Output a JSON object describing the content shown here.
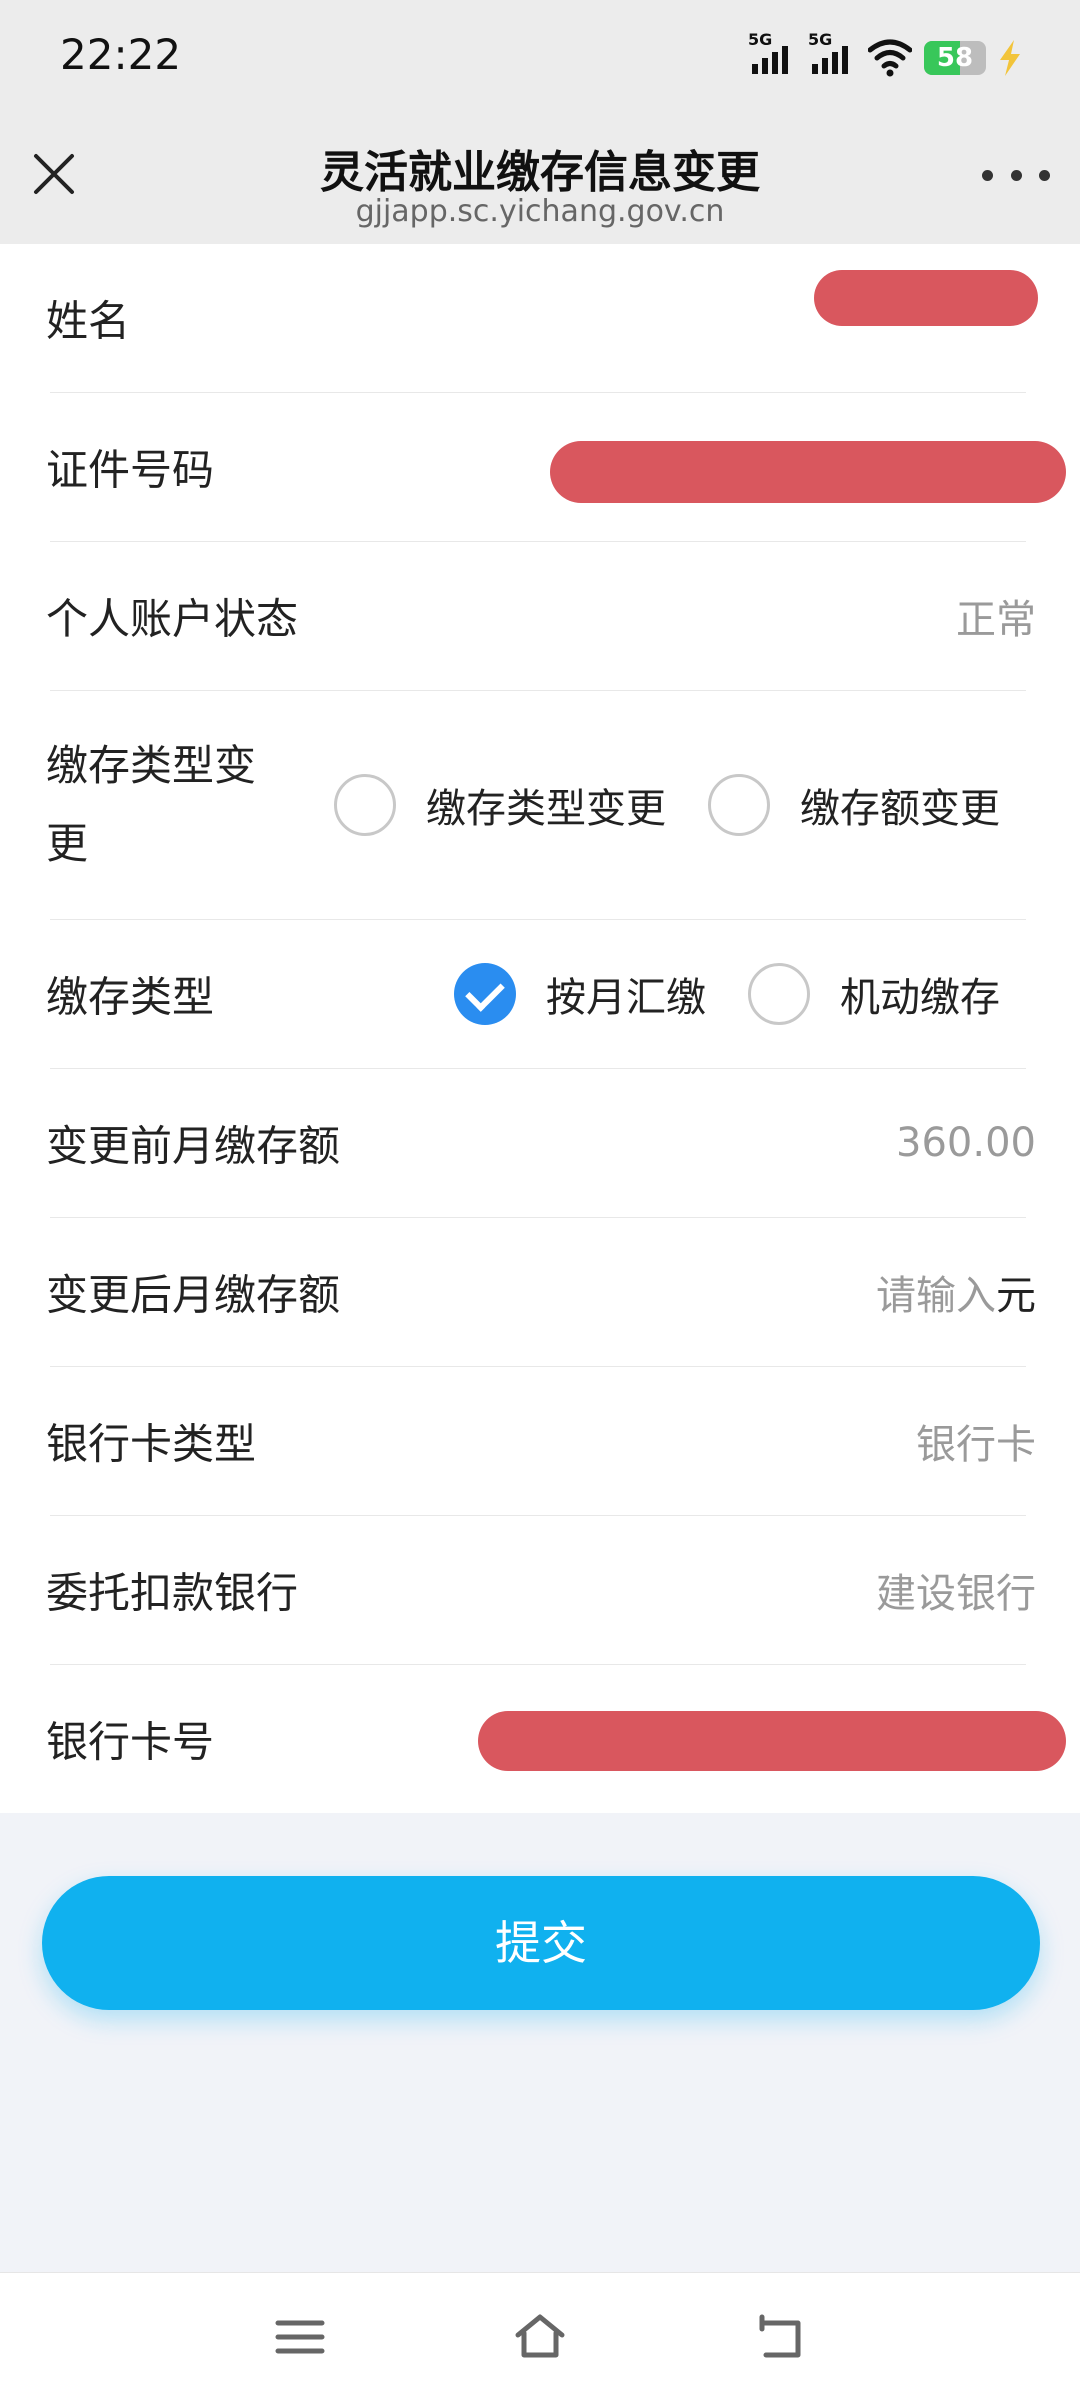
{
  "status": {
    "time": "22:22",
    "signal1_label": "5G",
    "signal2_label": "5G",
    "battery_percent": "58"
  },
  "header": {
    "title": "灵活就业缴存信息变更",
    "url": "gjjapp.sc.yichang.gov.cn"
  },
  "form": {
    "name": {
      "label": "姓名",
      "value_redacted": true
    },
    "id_number": {
      "label": "证件号码",
      "value_redacted": true
    },
    "account_status": {
      "label": "个人账户状态",
      "value": "正常"
    },
    "change_type": {
      "label": "缴存类型变更",
      "options": [
        {
          "label": "缴存类型变更",
          "checked": false
        },
        {
          "label": "缴存额变更",
          "checked": false
        }
      ]
    },
    "deposit_type": {
      "label": "缴存类型",
      "options": [
        {
          "label": "按月汇缴",
          "checked": true
        },
        {
          "label": "机动缴存",
          "checked": false
        }
      ]
    },
    "before_amount": {
      "label": "变更前月缴存额",
      "value": "360.00"
    },
    "after_amount": {
      "label": "变更后月缴存额",
      "placeholder": "请输入",
      "suffix": "元"
    },
    "card_type": {
      "label": "银行卡类型",
      "value": "银行卡"
    },
    "bank": {
      "label": "委托扣款银行",
      "value": "建设银行"
    },
    "card_number": {
      "label": "银行卡号",
      "value_redacted": true
    }
  },
  "submit": {
    "label": "提交"
  },
  "colors": {
    "primary": "#10b1ef",
    "checked": "#2a8df0",
    "redaction": "#d9575e"
  }
}
